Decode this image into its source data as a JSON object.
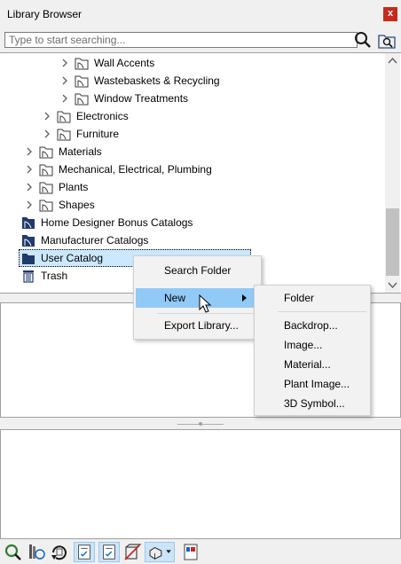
{
  "window": {
    "title": "Library Browser",
    "close_label": "x"
  },
  "search": {
    "placeholder": "Type to start searching..."
  },
  "tree": {
    "rows": [
      {
        "label": "Wall Accents",
        "expandable": true
      },
      {
        "label": "Wastebaskets & Recycling",
        "expandable": true
      },
      {
        "label": "Window Treatments",
        "expandable": true
      },
      {
        "label": "Electronics",
        "expandable": true
      },
      {
        "label": "Furniture",
        "expandable": true
      },
      {
        "label": "Materials",
        "expandable": true
      },
      {
        "label": "Mechanical, Electrical, Plumbing",
        "expandable": true
      },
      {
        "label": "Plants",
        "expandable": true
      },
      {
        "label": "Shapes",
        "expandable": true
      },
      {
        "label": "Home Designer Bonus Catalogs",
        "expandable": false
      },
      {
        "label": "Manufacturer Catalogs",
        "expandable": false
      },
      {
        "label": "User Catalog",
        "expandable": false,
        "selected": true
      },
      {
        "label": "Trash",
        "expandable": false
      }
    ]
  },
  "context_menu": {
    "items": [
      "Search Folder",
      "New",
      "Export Library..."
    ],
    "highlighted": "New"
  },
  "submenu_new": {
    "items": [
      "Folder",
      "Backdrop...",
      "Image...",
      "Material...",
      "Plant Image...",
      "3D Symbol..."
    ]
  },
  "toolbar": {
    "icons": [
      "search-library-icon",
      "library-settings-icon",
      "refresh-icon",
      "view-mode-icon",
      "view-mode-alt-icon",
      "clear-icon",
      "library-tools-icon",
      "dropdown-icon",
      "preview-icon"
    ]
  },
  "colors": {
    "selection": "#cce8ff",
    "menu_highlight": "#91c9f7",
    "close_button": "#c42b1c",
    "catalog_icon": "#1f3a6b"
  }
}
